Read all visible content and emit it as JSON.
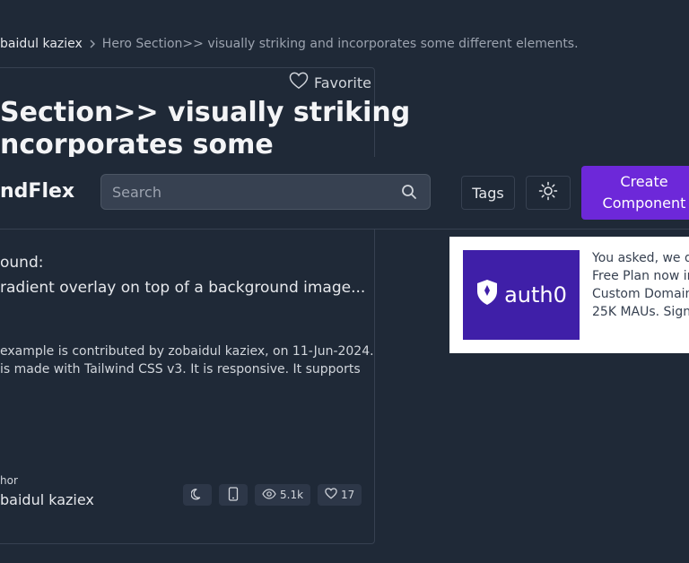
{
  "breadcrumb": {
    "author": "baidul kaziex",
    "current": "Hero Section>> visually striking and incorporates some different elements."
  },
  "favorite": {
    "label": "Favorite",
    "icon": "heart-icon"
  },
  "title": {
    "line1": "Section>> visually striking",
    "line2": "ncorporates some"
  },
  "navbar": {
    "logo": "ndFlex",
    "search_placeholder": "Search",
    "tags_label": "Tags",
    "theme_icon": "sun-icon",
    "create_line1": "Create",
    "create_line2": "Component",
    "accent": "#6d28d9"
  },
  "description": {
    "label": "ound:",
    "text": "radient overlay on top of a background image..."
  },
  "meta": {
    "line1": "example is contributed by zobaidul kaziex, on 11-Jun-2024.",
    "line2": "is made with Tailwind CSS v3. It is responsive. It supports"
  },
  "author": {
    "label": "hor",
    "name": "baidul kaziex"
  },
  "stats": {
    "views": "5.1k",
    "likes": "17"
  },
  "ad": {
    "logo_text": "auth0",
    "line1": "You asked, we de",
    "line2": "Free Plan now in",
    "line3": "Custom Domain,",
    "line4": "25K MAUs. Sign u",
    "brand": "#3f1fa8"
  }
}
